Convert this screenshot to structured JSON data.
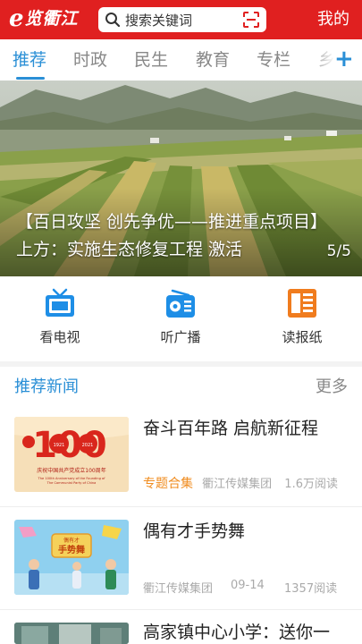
{
  "header": {
    "logo_e": "e",
    "logo_text": "览衢江",
    "search_placeholder": "搜索关键词",
    "mine_label": "我的"
  },
  "tabs": [
    {
      "label": "推荐",
      "active": true
    },
    {
      "label": "时政",
      "active": false
    },
    {
      "label": "民生",
      "active": false
    },
    {
      "label": "教育",
      "active": false
    },
    {
      "label": "专栏",
      "active": false
    },
    {
      "label": "乡",
      "active": false
    }
  ],
  "banner": {
    "caption": "【百日攻坚 创先争优——推进重点项目】上方：实施生态修复工程 激活",
    "page_indicator": "5/5"
  },
  "quick_links": [
    {
      "label": "看电视",
      "icon": "tv-icon"
    },
    {
      "label": "听广播",
      "icon": "radio-icon"
    },
    {
      "label": "读报纸",
      "icon": "newspaper-icon"
    }
  ],
  "section": {
    "title": "推荐新闻",
    "more_label": "更多"
  },
  "news": [
    {
      "title": "奋斗百年路 启航新征程",
      "tag": "专题合集",
      "source": "衢江传媒集团",
      "date": "",
      "reads": "1.6万阅读",
      "thumb_text": {
        "big": "100",
        "year_left": "1921",
        "year_right": "2021",
        "line1": "庆祝中国共产党成立100周年",
        "line2": "The 100th Anniversary of the Founding of",
        "line3": "The Communist Party of China"
      }
    },
    {
      "title": "偶有才手势舞",
      "tag": "",
      "source": "衢江传媒集团",
      "date": "09-14",
      "reads": "1357阅读",
      "thumb_text": {
        "sign_top": "偶有才",
        "sign_main": "手势舞"
      }
    },
    {
      "title": "高家镇中心小学：送你一",
      "tag": "",
      "source": "",
      "date": "",
      "reads": "",
      "thumb_text": {}
    }
  ],
  "colors": {
    "brand_red": "#e02020",
    "accent_blue": "#2a8fd6",
    "tag_orange": "#f08c1f"
  }
}
